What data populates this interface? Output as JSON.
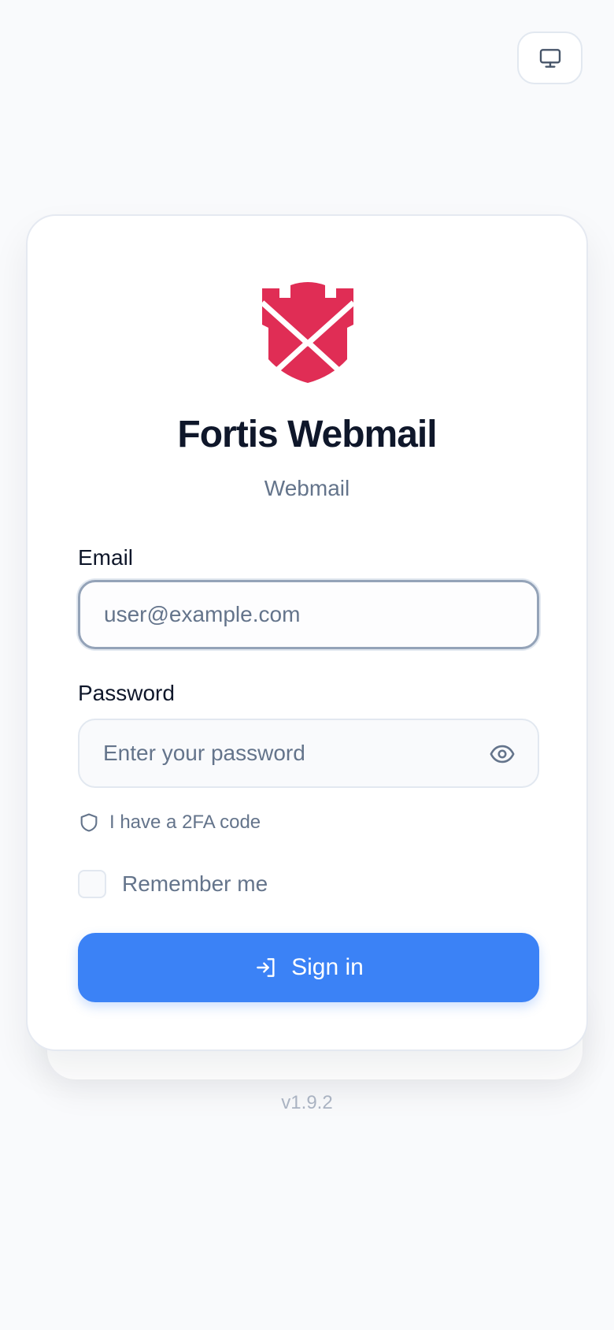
{
  "theme_toggle": {
    "icon": "monitor-icon"
  },
  "brand": {
    "title": "Fortis Webmail",
    "subtitle": "Webmail",
    "logo_icon": "tower-envelope-logo",
    "logo_color": "#e02d55"
  },
  "form": {
    "email": {
      "label": "Email",
      "value": "",
      "placeholder": "user@example.com"
    },
    "password": {
      "label": "Password",
      "value": "",
      "placeholder": "Enter your password",
      "toggle_icon": "eye-icon"
    },
    "twofa": {
      "label": "I have a 2FA code",
      "icon": "shield-icon"
    },
    "remember": {
      "label": "Remember me",
      "checked": false
    },
    "submit": {
      "label": "Sign in",
      "icon": "login-icon"
    }
  },
  "footer": {
    "version": "v1.9.2"
  },
  "colors": {
    "accent": "#3b82f6",
    "logo": "#e02d55",
    "text_primary": "#0f172a",
    "text_muted": "#64748b"
  }
}
